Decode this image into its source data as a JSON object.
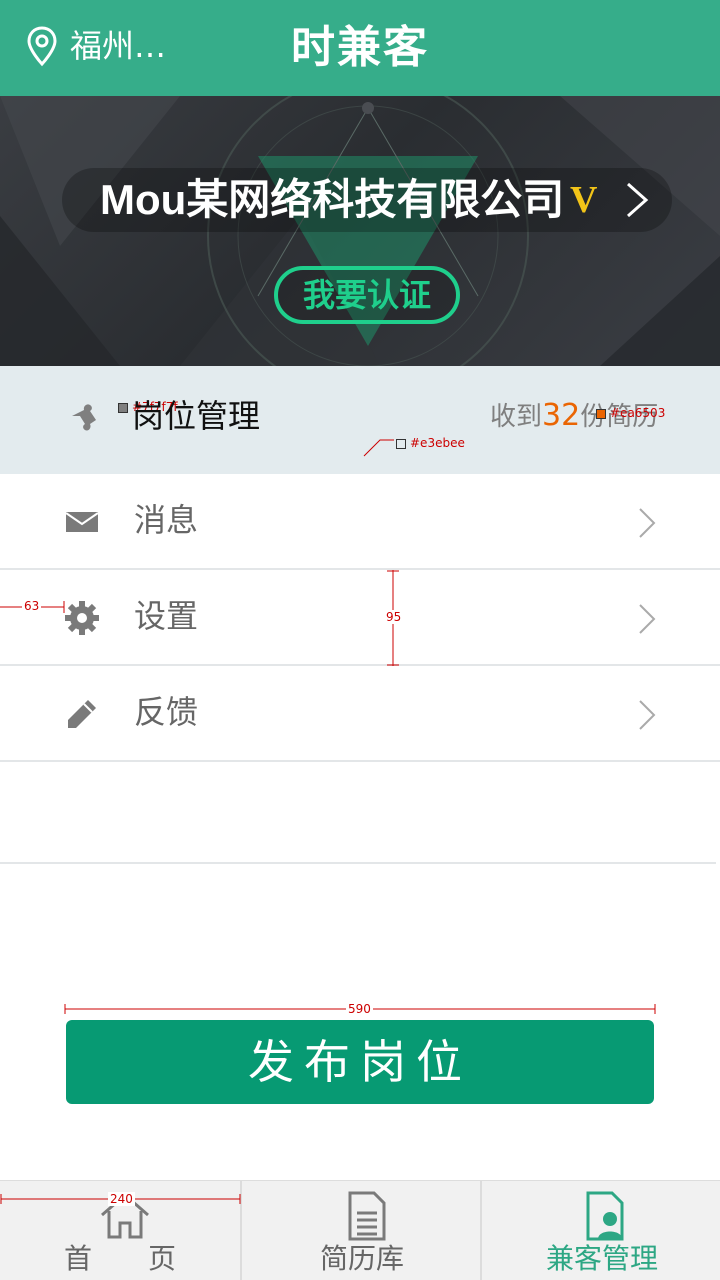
{
  "header": {
    "location": "福州…",
    "location_icon": "location-pin-icon",
    "title": "时兼客"
  },
  "banner": {
    "company_name": "Mou某网络科技有限公司",
    "vip_badge": "V",
    "certify_button": "我要认证",
    "vip_color": "#f2c418",
    "certify_color": "#1fcf8c"
  },
  "job_management": {
    "label": "岗位管理",
    "received_prefix": "收到",
    "received_count": "32",
    "received_suffix": "份简历",
    "count_color": "#ea6503",
    "background_color": "#e3ebee",
    "annotations": {
      "icon_color_note": "#7f7f7f",
      "bg_color_note": "#e3ebee",
      "count_color_note": "#ea6503"
    }
  },
  "menu": {
    "items": [
      {
        "label": "消息",
        "icon": "envelope-icon"
      },
      {
        "label": "设置",
        "icon": "gear-icon"
      },
      {
        "label": "反馈",
        "icon": "pencil-icon"
      }
    ]
  },
  "measurements": {
    "icon_offset": "63",
    "row_height": "95",
    "button_width": "590",
    "tab_width": "240"
  },
  "publish_button": "发布岗位",
  "tabbar": {
    "tabs": [
      {
        "label": "首　　页",
        "icon": "home-icon",
        "active": false
      },
      {
        "label": "简历库",
        "icon": "document-icon",
        "active": false
      },
      {
        "label": "兼客管理",
        "icon": "user-file-icon",
        "active": true
      }
    ],
    "active_color": "#2da784"
  },
  "colors": {
    "primary": "#36ad8a",
    "button": "#079a73"
  }
}
